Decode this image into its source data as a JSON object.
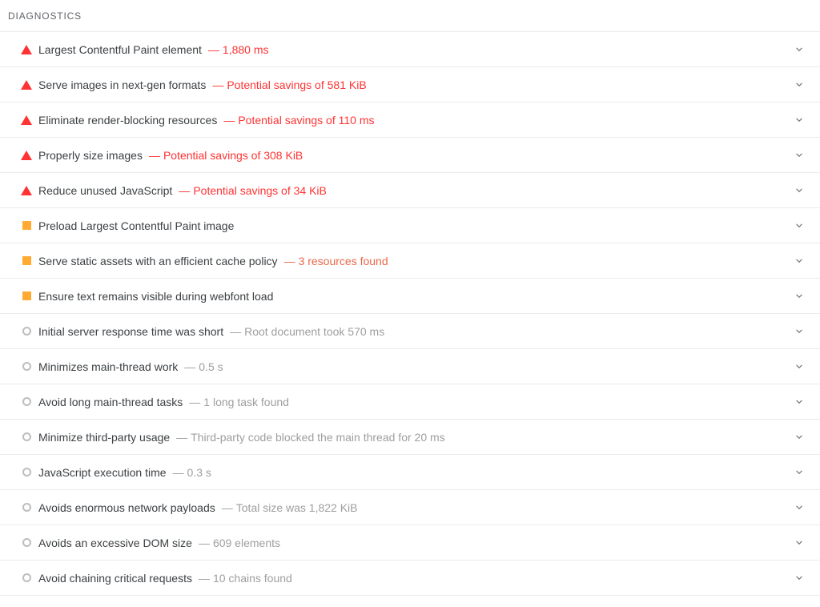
{
  "section": {
    "header_label": "DIAGNOSTICS"
  },
  "colors": {
    "fail": "#f33",
    "average": "#fa3",
    "average_text": "#e8684a",
    "informative": "#bdbdbd",
    "title_text": "#3c4043",
    "header_text": "#5f6368",
    "divider": "#ebebeb",
    "background": "#ffffff"
  },
  "icons": {
    "fail": "triangle-icon",
    "average": "square-icon",
    "informative": "circle-icon",
    "expand": "chevron-down-icon"
  },
  "separator": "—",
  "audits": [
    {
      "score_class": "fail",
      "icon": "triangle-icon",
      "title": "Largest Contentful Paint element",
      "display_value": "1,880 ms",
      "expand_icon": "chevron-down-icon"
    },
    {
      "score_class": "fail",
      "icon": "triangle-icon",
      "title": "Serve images in next-gen formats",
      "display_value": "Potential savings of 581 KiB",
      "expand_icon": "chevron-down-icon"
    },
    {
      "score_class": "fail",
      "icon": "triangle-icon",
      "title": "Eliminate render-blocking resources",
      "display_value": "Potential savings of 110 ms",
      "expand_icon": "chevron-down-icon"
    },
    {
      "score_class": "fail",
      "icon": "triangle-icon",
      "title": "Properly size images",
      "display_value": "Potential savings of 308 KiB",
      "expand_icon": "chevron-down-icon"
    },
    {
      "score_class": "fail",
      "icon": "triangle-icon",
      "title": "Reduce unused JavaScript",
      "display_value": "Potential savings of 34 KiB",
      "expand_icon": "chevron-down-icon"
    },
    {
      "score_class": "average",
      "icon": "square-icon",
      "title": "Preload Largest Contentful Paint image",
      "display_value": "",
      "expand_icon": "chevron-down-icon"
    },
    {
      "score_class": "average",
      "icon": "square-icon",
      "title": "Serve static assets with an efficient cache policy",
      "display_value": "3 resources found",
      "expand_icon": "chevron-down-icon"
    },
    {
      "score_class": "average",
      "icon": "square-icon",
      "title": "Ensure text remains visible during webfont load",
      "display_value": "",
      "expand_icon": "chevron-down-icon"
    },
    {
      "score_class": "informative",
      "icon": "circle-icon",
      "title": "Initial server response time was short",
      "display_value": "Root document took 570 ms",
      "expand_icon": "chevron-down-icon"
    },
    {
      "score_class": "informative",
      "icon": "circle-icon",
      "title": "Minimizes main-thread work",
      "display_value": "0.5 s",
      "expand_icon": "chevron-down-icon"
    },
    {
      "score_class": "informative",
      "icon": "circle-icon",
      "title": "Avoid long main-thread tasks",
      "display_value": "1 long task found",
      "expand_icon": "chevron-down-icon"
    },
    {
      "score_class": "informative",
      "icon": "circle-icon",
      "title": "Minimize third-party usage",
      "display_value": "Third-party code blocked the main thread for 20 ms",
      "expand_icon": "chevron-down-icon"
    },
    {
      "score_class": "informative",
      "icon": "circle-icon",
      "title": "JavaScript execution time",
      "display_value": "0.3 s",
      "expand_icon": "chevron-down-icon"
    },
    {
      "score_class": "informative",
      "icon": "circle-icon",
      "title": "Avoids enormous network payloads",
      "display_value": "Total size was 1,822 KiB",
      "expand_icon": "chevron-down-icon"
    },
    {
      "score_class": "informative",
      "icon": "circle-icon",
      "title": "Avoids an excessive DOM size",
      "display_value": "609 elements",
      "expand_icon": "chevron-down-icon"
    },
    {
      "score_class": "informative",
      "icon": "circle-icon",
      "title": "Avoid chaining critical requests",
      "display_value": "10 chains found",
      "expand_icon": "chevron-down-icon"
    }
  ]
}
